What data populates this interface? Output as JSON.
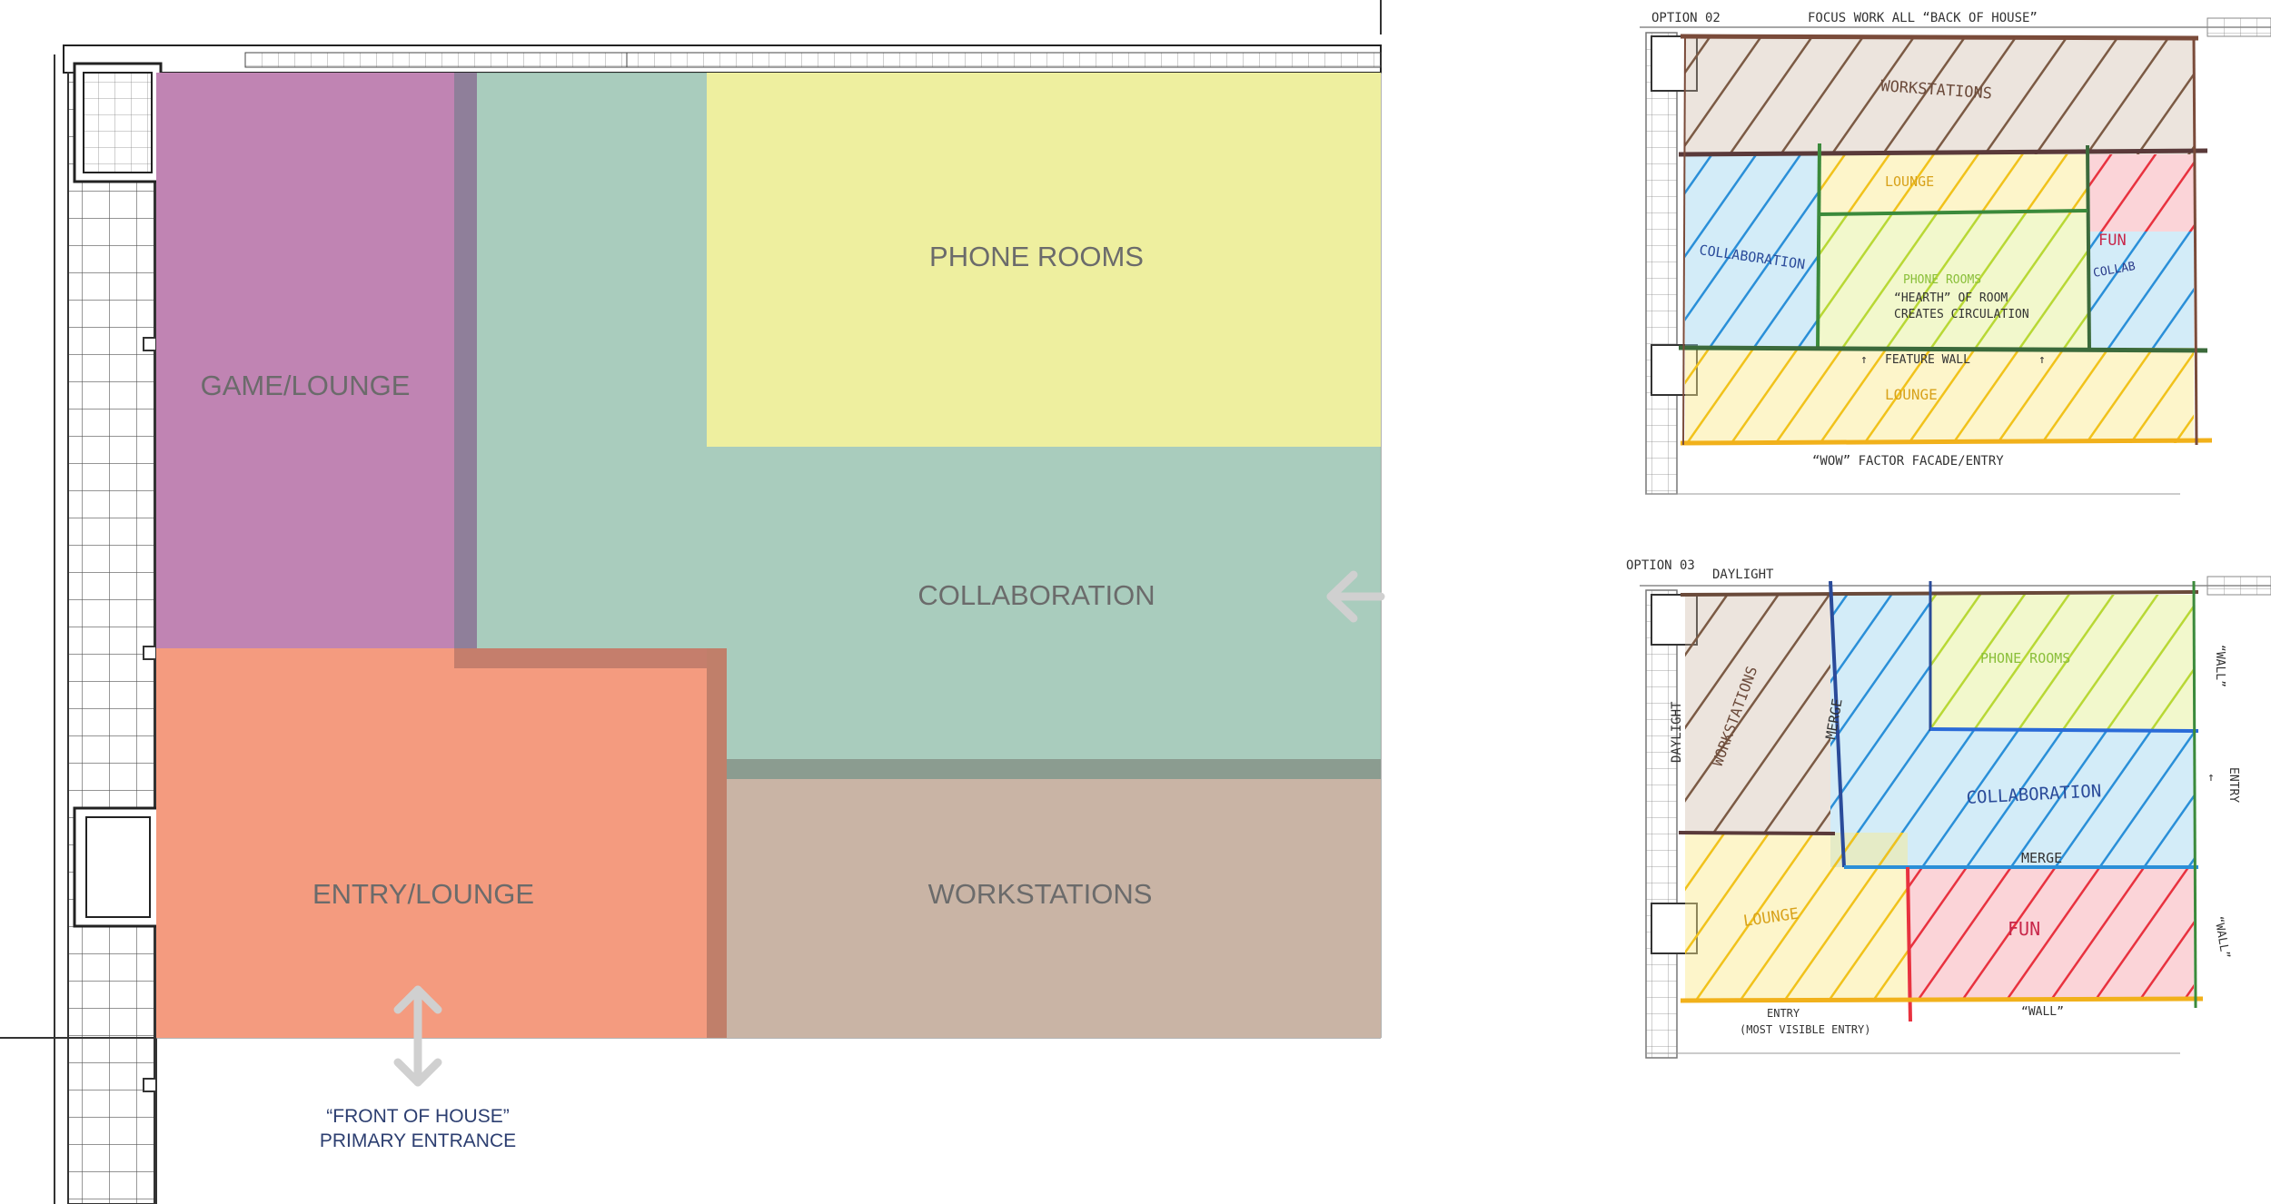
{
  "main_plan": {
    "zones": {
      "game_lounge": "GAME/LOUNGE",
      "phone_rooms": "PHONE ROOMS",
      "collaboration": "COLLABORATION",
      "entry_lounge": "ENTRY/LOUNGE",
      "workstations": "WORKSTATIONS"
    },
    "entrance_note": {
      "line1": "“FRONT OF HOUSE”",
      "line2": "PRIMARY ENTRANCE"
    },
    "colors": {
      "game_lounge": "#c084b3",
      "collaboration": "#a2c8b8",
      "phone_rooms": "#eeef9f",
      "entry_lounge": "#f49b7f",
      "workstations": "#c9b4a5",
      "arrow": "#d0d0d0",
      "note_text": "#2c3e70"
    }
  },
  "option_02": {
    "header": "OPTION 02",
    "caption": "FOCUS WORK ALL “BACK OF HOUSE”",
    "labels": {
      "workstations": "WORKSTATIONS",
      "lounge_top": "LOUNGE",
      "collaboration": "COLLABORATION",
      "phone_rooms": "PHONE ROOMS",
      "hearth_1": "“HEARTH” OF ROOM",
      "hearth_2": "CREATES CIRCULATION",
      "fun": "FUN",
      "collab_small": "COLLAB",
      "feature_wall": "FEATURE WALL",
      "lounge_bottom": "LOUNGE",
      "facade": "“WOW” FACTOR FACADE/ENTRY"
    }
  },
  "option_03": {
    "header": "OPTION 03",
    "labels": {
      "daylight_top": "DAYLIGHT",
      "daylight_side": "DAYLIGHT",
      "workstations": "WORKSTATIONS",
      "merge_1": "MERGE",
      "phone_rooms": "PHONE ROOMS",
      "wall_right_top": "“WALL”",
      "entry_right": "ENTRY",
      "collaboration": "COLLABORATION",
      "merge_2": "MERGE",
      "lounge": "LOUNGE",
      "fun": "FUN",
      "wall_right_bottom": "“WALL”",
      "wall_bottom": "“WALL”",
      "entry_bottom": "ENTRY",
      "entry_bottom_note": "(MOST VISIBLE ENTRY)"
    }
  }
}
